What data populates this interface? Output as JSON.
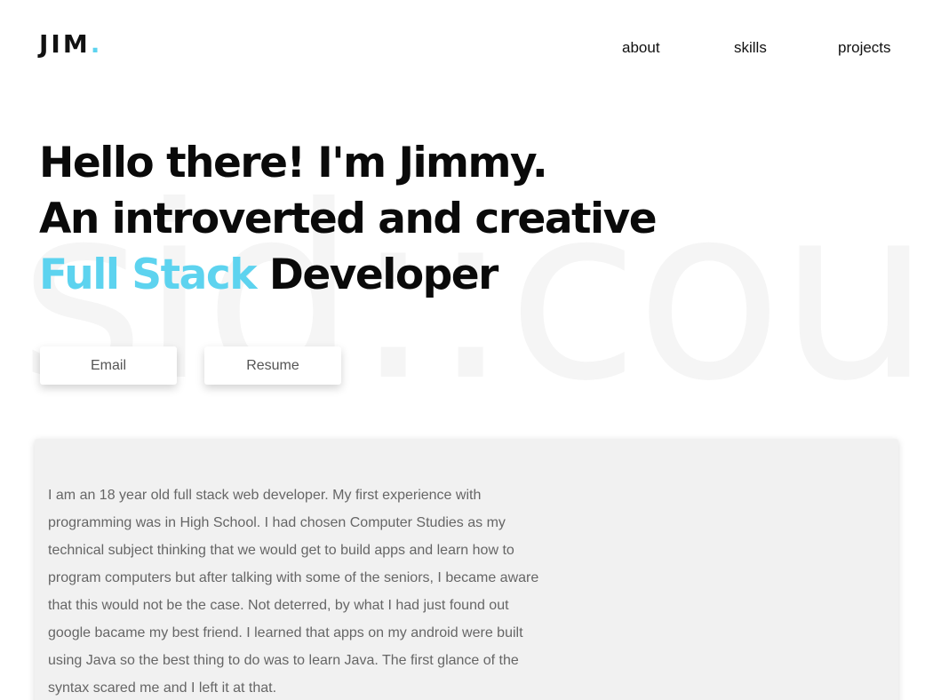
{
  "background": {
    "watermark_text": "sid::cou"
  },
  "header": {
    "logo_text": "JIM",
    "logo_dot": ".",
    "nav": [
      {
        "label": "about"
      },
      {
        "label": "skills"
      },
      {
        "label": "projects"
      }
    ]
  },
  "hero": {
    "line1": "Hello there! I'm Jimmy.",
    "line2": "An introverted and creative",
    "line3_accent": "Full Stack",
    "line3_rest": " Developer"
  },
  "buttons": {
    "email_label": "Email",
    "resume_label": "Resume"
  },
  "about": {
    "paragraph": "I am an 18 year old full stack web developer. My first experience with programming was in High School. I had chosen Computer Studies as my technical subject thinking that we would get to build apps and learn how to program computers but after talking with some of the seniors, I became aware that this would not be the case. Not deterred, by what I had just found out google bacame my best friend. I learned that apps on my android were built using Java so the best thing to do was to learn Java. The first glance of the syntax scared me and I left it at that."
  },
  "colors": {
    "accent": "#5dd3ef",
    "text": "#0a0a0a",
    "muted_text": "#666666",
    "card_background": "#f1f1f1",
    "watermark": "#f5f5f5"
  }
}
